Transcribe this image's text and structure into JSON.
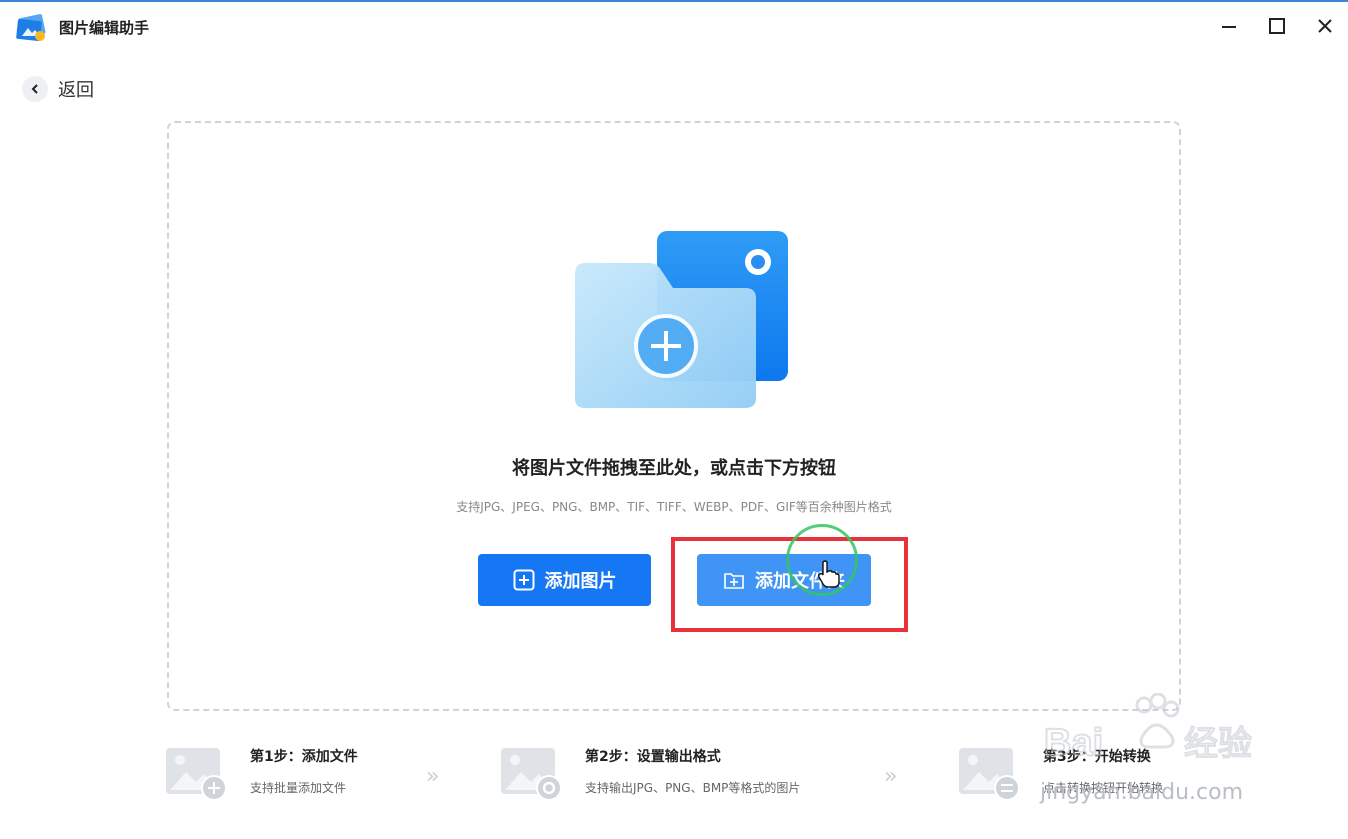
{
  "window": {
    "title": "图片编辑助手"
  },
  "nav": {
    "back_label": "返回"
  },
  "dropzone": {
    "title": "将图片文件拖拽至此处，或点击下方按钮",
    "subtitle": "支持JPG、JPEG、PNG、BMP、TIF、TIFF、WEBP、PDF、GIF等百余种图片格式",
    "add_image_label": "添加图片",
    "add_folder_label": "添加文件夹"
  },
  "steps": [
    {
      "title": "第1步：添加文件",
      "desc": "支持批量添加文件",
      "icon": "image-add-icon"
    },
    {
      "title": "第2步：设置输出格式",
      "desc": "支持输出JPG、PNG、BMP等格式的图片",
      "icon": "image-settings-icon"
    },
    {
      "title": "第3步：开始转换",
      "desc": "点击转换按钮开始转换",
      "icon": "image-convert-icon"
    }
  ],
  "watermark": {
    "brand": "Bai 经验",
    "site": "jingyan.baidu.com"
  },
  "colors": {
    "primary": "#1677f5",
    "primary_hover": "#3f94f6",
    "highlight": "#e8323a",
    "click_ring": "#36c463",
    "topline": "#3d86d8"
  }
}
